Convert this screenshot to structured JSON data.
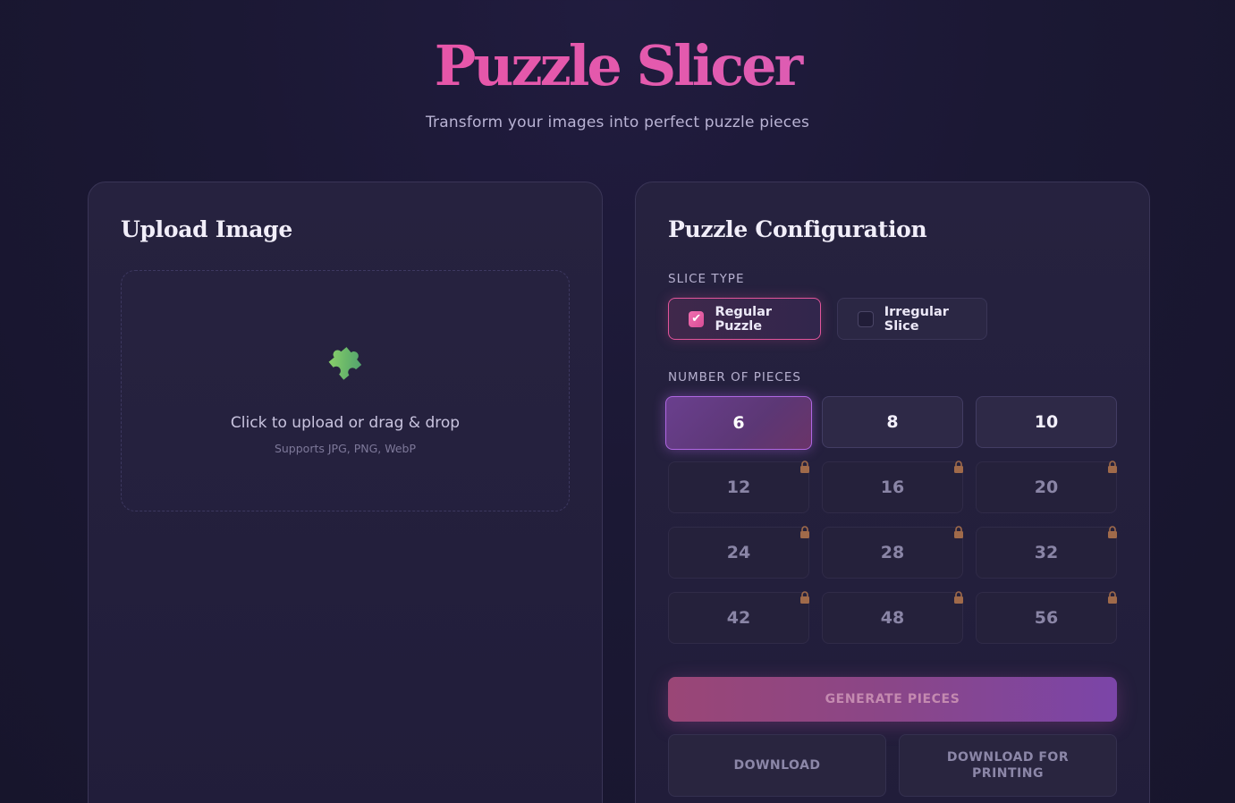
{
  "header": {
    "title": "Puzzle Slicer",
    "subtitle": "Transform your images into perfect puzzle pieces"
  },
  "upload": {
    "heading": "Upload Image",
    "icon": "puzzle-piece-icon",
    "drop_text": "Click to upload or drag & drop",
    "drop_hint": "Supports JPG, PNG, WebP"
  },
  "config": {
    "heading": "Puzzle Configuration",
    "slice_type_label": "SLICE TYPE",
    "slice_types": [
      {
        "label": "Regular Puzzle",
        "checked": true
      },
      {
        "label": "Irregular Slice",
        "checked": false
      }
    ],
    "pieces_label": "NUMBER OF PIECES",
    "pieces": [
      {
        "value": "6",
        "state": "selected"
      },
      {
        "value": "8",
        "state": "unlocked"
      },
      {
        "value": "10",
        "state": "unlocked"
      },
      {
        "value": "12",
        "state": "locked"
      },
      {
        "value": "16",
        "state": "locked"
      },
      {
        "value": "20",
        "state": "locked"
      },
      {
        "value": "24",
        "state": "locked"
      },
      {
        "value": "28",
        "state": "locked"
      },
      {
        "value": "32",
        "state": "locked"
      },
      {
        "value": "42",
        "state": "locked"
      },
      {
        "value": "48",
        "state": "locked"
      },
      {
        "value": "56",
        "state": "locked"
      }
    ],
    "generate_label": "GENERATE PIECES",
    "download_label": "DOWNLOAD",
    "download_print_label": "DOWNLOAD FOR PRINTING"
  },
  "colors": {
    "accent_pink": "#e2559b",
    "accent_purple": "#b067e3",
    "lock": "#a06a4a"
  }
}
